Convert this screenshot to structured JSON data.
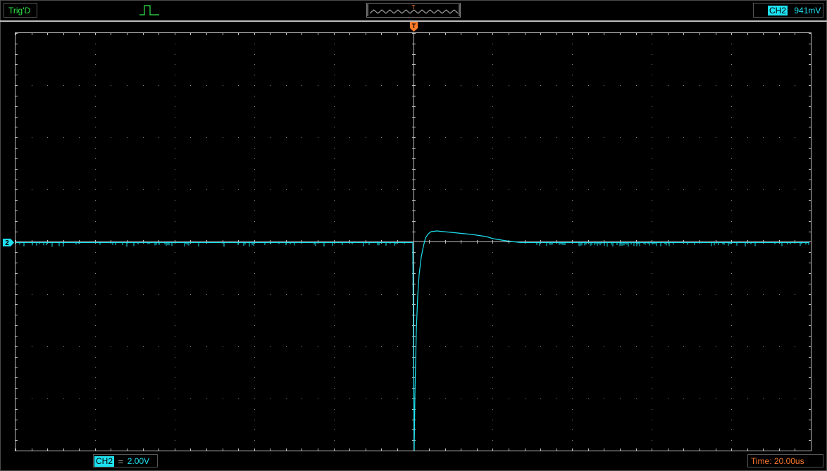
{
  "header": {
    "trigger_status": "Trig'D",
    "trigger_marker": "T",
    "channel_tag": "CH2",
    "channel_value": "941mV"
  },
  "trace": {
    "channel_marker": "2",
    "color": "#1de1f0"
  },
  "footer": {
    "channel_tag": "CH2",
    "coupling": "⚌",
    "volts_per_div": "2.00V",
    "timebase": "Time: 20.00us"
  },
  "colors": {
    "trace": "#1de1f0",
    "trigger": "#ff7a2a",
    "status": "#2ee84a"
  }
}
